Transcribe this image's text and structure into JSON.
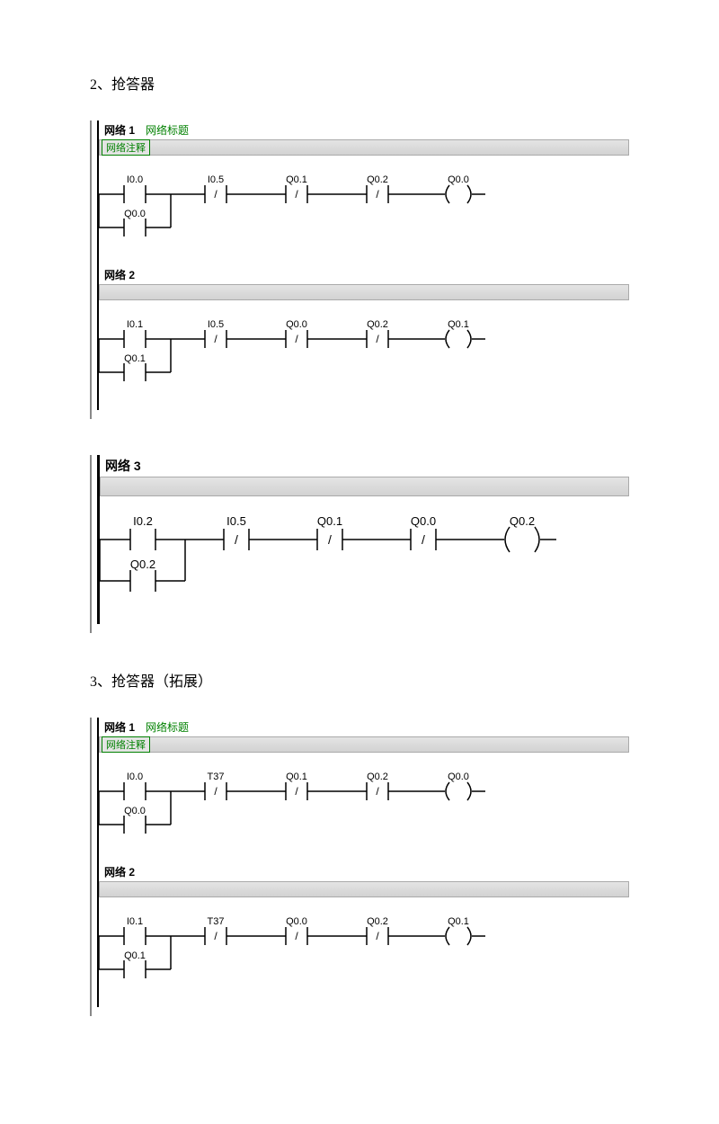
{
  "sections": [
    {
      "num": "2",
      "title": "抢答器"
    },
    {
      "num": "3",
      "title": "抢答器（拓展）"
    }
  ],
  "net_label_prefix": "网络",
  "net_title": "网络标题",
  "net_comment": "网络注释",
  "block1": {
    "n1": {
      "num": "1",
      "row": [
        "I0.0",
        "I0.5",
        "Q0.1",
        "Q0.2",
        "Q0.0"
      ],
      "branch": "Q0.0",
      "types": [
        "no",
        "nc",
        "nc",
        "nc",
        "coil"
      ]
    },
    "n2": {
      "num": "2",
      "row": [
        "I0.1",
        "I0.5",
        "Q0.0",
        "Q0.2",
        "Q0.1"
      ],
      "branch": "Q0.1",
      "types": [
        "no",
        "nc",
        "nc",
        "nc",
        "coil"
      ]
    }
  },
  "block2": {
    "n3": {
      "num": "3",
      "row": [
        "I0.2",
        "I0.5",
        "Q0.1",
        "Q0.0",
        "Q0.2"
      ],
      "branch": "Q0.2",
      "types": [
        "no",
        "nc",
        "nc",
        "nc",
        "coil"
      ]
    }
  },
  "block3": {
    "n1": {
      "num": "1",
      "row": [
        "I0.0",
        "T37",
        "Q0.1",
        "Q0.2",
        "Q0.0"
      ],
      "branch": "Q0.0",
      "types": [
        "no",
        "nc",
        "nc",
        "nc",
        "coil"
      ]
    },
    "n2": {
      "num": "2",
      "row": [
        "I0.1",
        "T37",
        "Q0.0",
        "Q0.2",
        "Q0.1"
      ],
      "branch": "Q0.1",
      "types": [
        "no",
        "nc",
        "nc",
        "nc",
        "coil"
      ]
    }
  }
}
